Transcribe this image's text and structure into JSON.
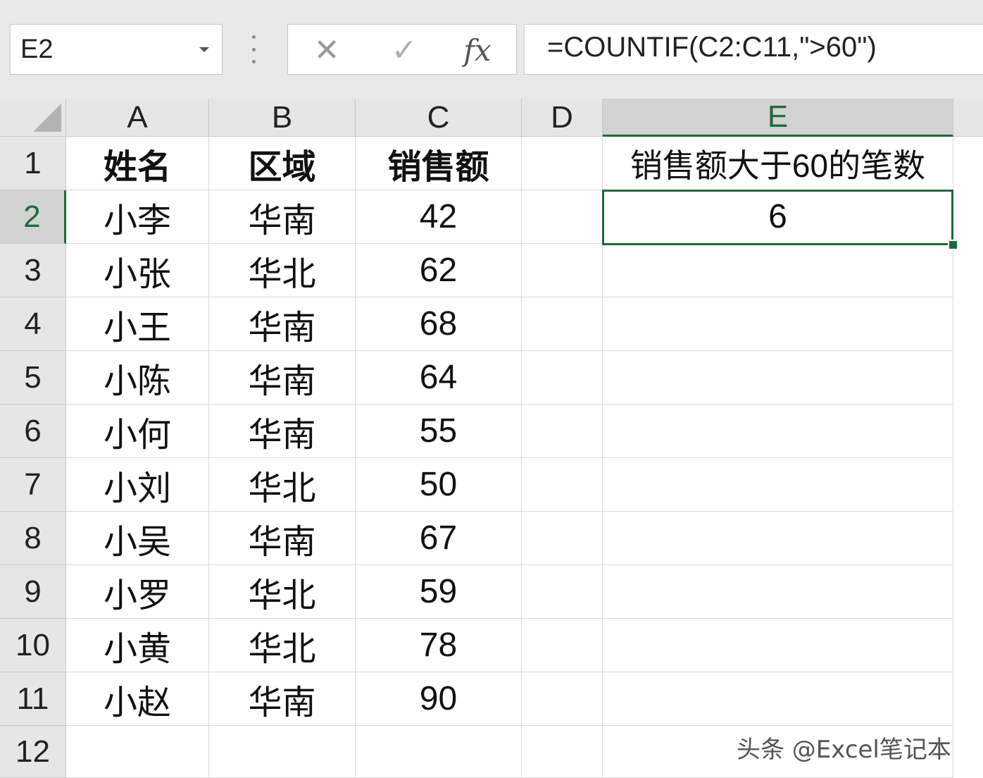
{
  "formula_bar": {
    "name_box": "E2",
    "cancel_glyph": "✕",
    "enter_glyph": "✓",
    "fx_label": "fx",
    "formula": "=COUNTIF(C2:C11,\">60\")"
  },
  "columns": [
    "A",
    "B",
    "C",
    "D",
    "E"
  ],
  "selected_column": "E",
  "rows": [
    "1",
    "2",
    "3",
    "4",
    "5",
    "6",
    "7",
    "8",
    "9",
    "10",
    "11",
    "12"
  ],
  "selected_row": "2",
  "table": {
    "headers": [
      "姓名",
      "区域",
      "销售额"
    ],
    "records": [
      [
        "小李",
        "华南",
        "42"
      ],
      [
        "小张",
        "华北",
        "62"
      ],
      [
        "小王",
        "华南",
        "68"
      ],
      [
        "小陈",
        "华南",
        "64"
      ],
      [
        "小何",
        "华南",
        "55"
      ],
      [
        "小刘",
        "华北",
        "50"
      ],
      [
        "小吴",
        "华南",
        "67"
      ],
      [
        "小罗",
        "华北",
        "59"
      ],
      [
        "小黄",
        "华北",
        "78"
      ],
      [
        "小赵",
        "华南",
        "90"
      ]
    ]
  },
  "result": {
    "label": "销售额大于60的笔数",
    "value": "6"
  },
  "watermark": "头条 @Excel笔记本",
  "colors": {
    "accent": "#1e6b3c",
    "header_bg": "#e6e6e6",
    "toolbar_bg": "#e9e9e9"
  }
}
